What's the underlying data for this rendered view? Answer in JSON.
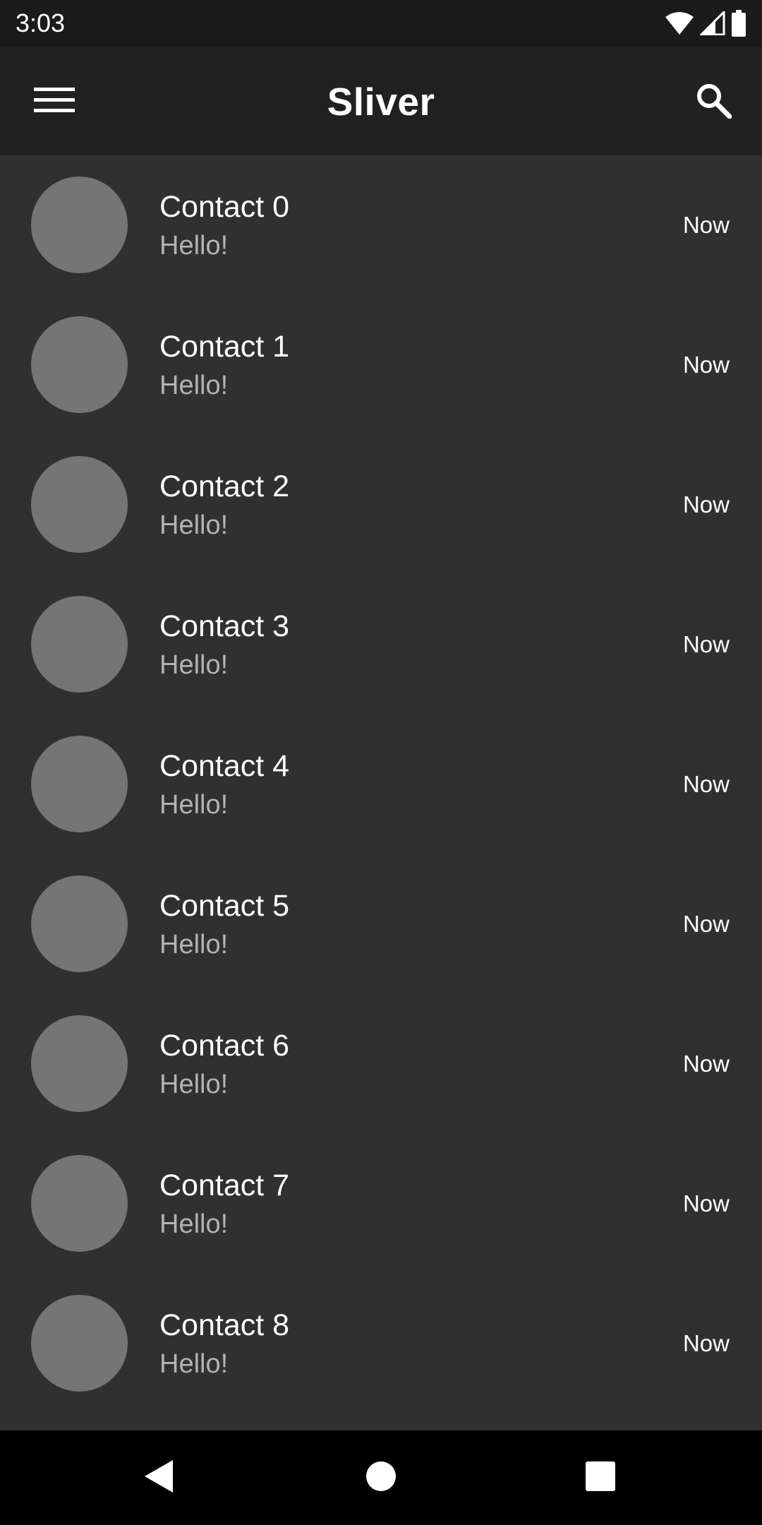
{
  "status_bar": {
    "time": "3:03"
  },
  "app_bar": {
    "title": "Sliver"
  },
  "contacts": [
    {
      "name": "Contact 0",
      "message": "Hello!",
      "time": "Now"
    },
    {
      "name": "Contact 1",
      "message": "Hello!",
      "time": "Now"
    },
    {
      "name": "Contact 2",
      "message": "Hello!",
      "time": "Now"
    },
    {
      "name": "Contact 3",
      "message": "Hello!",
      "time": "Now"
    },
    {
      "name": "Contact 4",
      "message": "Hello!",
      "time": "Now"
    },
    {
      "name": "Contact 5",
      "message": "Hello!",
      "time": "Now"
    },
    {
      "name": "Contact 6",
      "message": "Hello!",
      "time": "Now"
    },
    {
      "name": "Contact 7",
      "message": "Hello!",
      "time": "Now"
    },
    {
      "name": "Contact 8",
      "message": "Hello!",
      "time": "Now"
    }
  ],
  "icons": {
    "menu": "menu-icon",
    "search": "search-icon",
    "wifi": "wifi-icon",
    "signal": "signal-icon",
    "battery": "battery-icon",
    "back": "back-icon",
    "home": "home-icon",
    "recents": "recents-icon"
  },
  "colors": {
    "background": "#303030",
    "app_bar": "#212121",
    "status_bar": "#1b1b1b",
    "avatar": "#757575",
    "secondary_text": "#b3b3b3",
    "nav_bar": "#000000"
  }
}
